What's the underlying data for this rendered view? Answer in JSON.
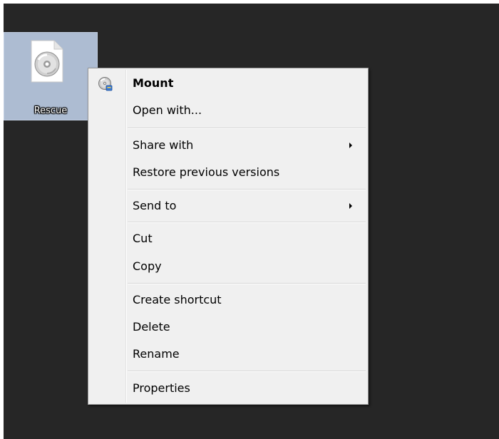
{
  "desktop": {
    "icon": {
      "label": "Rescue",
      "icon_name": "disc-image-file-icon"
    }
  },
  "context_menu": {
    "items": [
      {
        "label": "Mount",
        "bold": true,
        "icon": "disc-mount-icon",
        "submenu": false
      },
      {
        "label": "Open with...",
        "bold": false,
        "submenu": false
      },
      {
        "label": "Share with",
        "bold": false,
        "submenu": true
      },
      {
        "label": "Restore previous versions",
        "bold": false,
        "submenu": false
      },
      {
        "label": "Send to",
        "bold": false,
        "submenu": true
      },
      {
        "label": "Cut",
        "bold": false,
        "submenu": false
      },
      {
        "label": "Copy",
        "bold": false,
        "submenu": false
      },
      {
        "label": "Create shortcut",
        "bold": false,
        "submenu": false
      },
      {
        "label": "Delete",
        "bold": false,
        "submenu": false
      },
      {
        "label": "Rename",
        "bold": false,
        "submenu": false
      },
      {
        "label": "Properties",
        "bold": false,
        "submenu": false
      }
    ]
  },
  "colors": {
    "desktop_background": "#262626",
    "selection_tile": "#adbcd2",
    "menu_background": "#f0f0f0",
    "menu_border": "#979797"
  }
}
